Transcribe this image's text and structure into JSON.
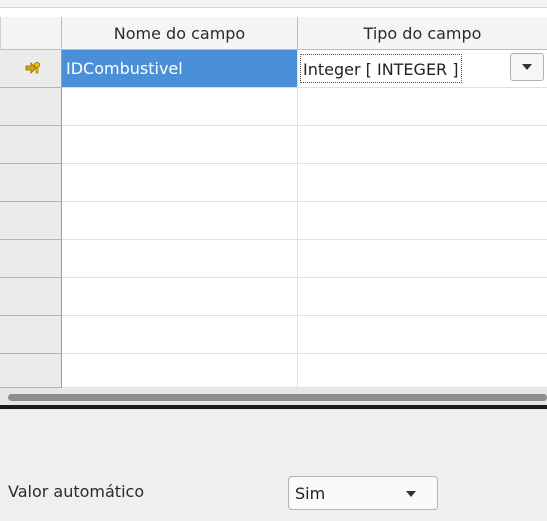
{
  "columns": {
    "field_name": "Nome do campo",
    "field_type": "Tipo do campo"
  },
  "rows": [
    {
      "name": "IDCombustivel",
      "type": "Integer [ INTEGER ]",
      "primary_key": true
    }
  ],
  "properties": {
    "auto_value_label": "Valor automático",
    "auto_value": "Sim"
  },
  "icons": {
    "primary_key": "primary-key-icon",
    "dropdown": "chevron-down-icon"
  },
  "colors": {
    "selection": "#4a90d9"
  }
}
